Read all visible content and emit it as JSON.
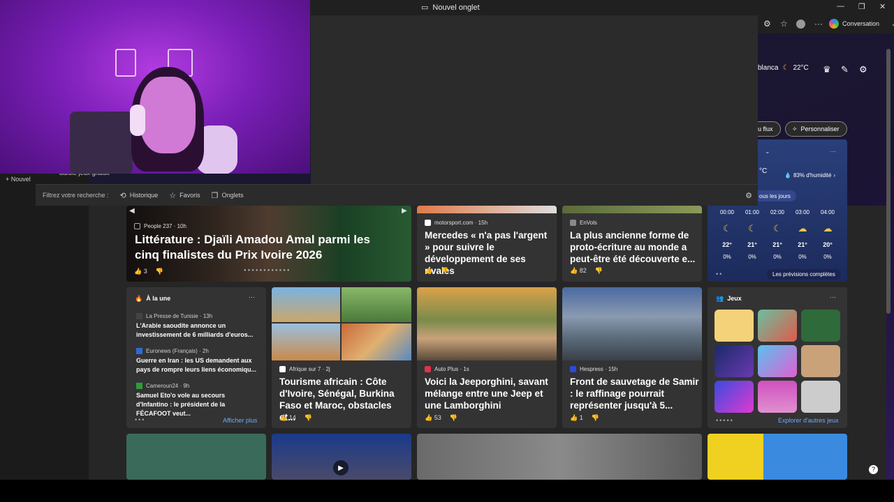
{
  "browser": {
    "tab_title": "Nouvel onglet",
    "conversation_label": "Conversation",
    "recent_search": "barbie jeux gratuit",
    "new_tab_label": "Nouvel"
  },
  "search_filter": {
    "label": "Filtrez votre recherche :",
    "options": [
      "Historique",
      "Favoris",
      "Onglets"
    ]
  },
  "header": {
    "city": "blanca",
    "temp": "22°C",
    "flux_label": "du flux",
    "personalize_label": "Personnaliser"
  },
  "hero": {
    "source": "People 237 · 10h",
    "title": "Littérature : Djaïli Amadou Amal parmi les cinq finalistes du Prix Ivoire 2026",
    "likes": "3"
  },
  "cards_top": [
    {
      "source": "motorsport.com · 15h",
      "title": "Mercedes « n'a pas l'argent » pour suivre le développement de ses rivales",
      "likes": ""
    },
    {
      "source": "EnVols",
      "title": "La plus ancienne forme de proto-écriture au monde a peut-être été découverte e...",
      "likes": "82"
    }
  ],
  "a_la_une": {
    "title": "À la une",
    "items": [
      {
        "source": "La Presse de Tunisie · 13h",
        "title": "L'Arabie saoudite annonce un investissement de 6 milliards d'euros..."
      },
      {
        "source": "Euronews (Français) · 2h",
        "title": "Guerre en Iran : les US demandent aux pays de rompre leurs liens économiqu..."
      },
      {
        "source": "Cameroun24 · 9h",
        "title": "Samuel Eto'o vole au secours d'Infantino : le président de la FÉCAFOOT veut..."
      }
    ],
    "show_more": "Afficher plus"
  },
  "cards_mid": [
    {
      "source": "Afrique sur 7 · 2j",
      "title": "Tourisme africain : Côte d'Ivoire, Sénégal, Burkina Faso et Maroc, obstacles et...",
      "likes": "14"
    },
    {
      "source": "Auto Plus · 1s",
      "title": "Voici la Jeeporghini, savant mélange entre une Jeep et une Lamborghini",
      "likes": "53"
    },
    {
      "source": "Hespress · 15h",
      "title": "Front de sauvetage de Samir : le raffinage pourrait représenter jusqu'à 5...",
      "likes": "1"
    }
  ],
  "weather": {
    "humidity": "83% d'humidité",
    "temp_unit": "°C",
    "days_label": "ous les jours",
    "hours": [
      "00:00",
      "01:00",
      "02:00",
      "03:00",
      "04:00"
    ],
    "temps": [
      "22°",
      "21°",
      "21°",
      "21°",
      "20°"
    ],
    "rain": [
      "0%",
      "0%",
      "0%",
      "0%",
      "0%"
    ],
    "forecast_link": "Les prévisions complètes"
  },
  "games": {
    "title": "Jeux",
    "explore": "Explorer d'autres jeux"
  },
  "colors": {
    "accent_blue": "#6ea8ff",
    "card_bg": "#333333",
    "weather_bg": "#2a3f7a"
  }
}
